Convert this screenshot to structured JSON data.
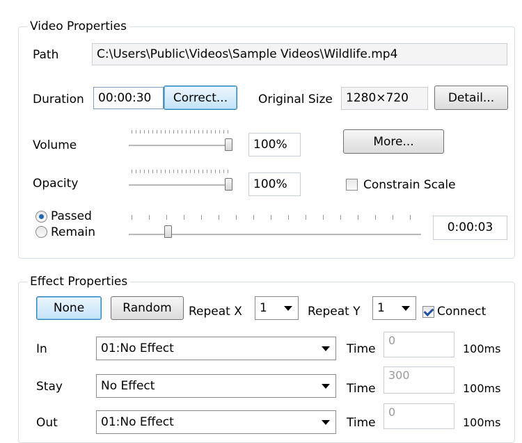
{
  "video": {
    "title": "Video Properties",
    "path_label": "Path",
    "path_value": "C:\\Users\\Public\\Videos\\Sample Videos\\Wildlife.mp4",
    "duration_label": "Duration",
    "duration_value": "00:00:30",
    "correct_button": "Correct...",
    "original_size_label": "Original Size",
    "original_size_value": "1280×720",
    "detail_button": "Detail...",
    "volume_label": "Volume",
    "volume_value": "100%",
    "more_button": "More...",
    "opacity_label": "Opacity",
    "opacity_value": "100%",
    "constrain_label": "Constrain Scale",
    "constrain_checked": false,
    "passed_label": "Passed",
    "remain_label": "Remain",
    "time_mode": "Passed",
    "position_value": "0:00:03"
  },
  "effect": {
    "title": "Effect Properties",
    "none_button": "None",
    "random_button": "Random",
    "repeat_x_label": "Repeat X",
    "repeat_x_value": "1",
    "repeat_y_label": "Repeat Y",
    "repeat_y_value": "1",
    "connect_label": "Connect",
    "connect_checked": true,
    "rows": [
      {
        "label": "In",
        "effect": "01:No Effect",
        "time_label": "Time",
        "time_value": "0",
        "unit": "100ms"
      },
      {
        "label": "Stay",
        "effect": "No Effect",
        "time_label": "Time",
        "time_value": "300",
        "unit": "100ms"
      },
      {
        "label": "Out",
        "effect": "01:No Effect",
        "time_label": "Time",
        "time_value": "0",
        "unit": "100ms"
      }
    ]
  }
}
